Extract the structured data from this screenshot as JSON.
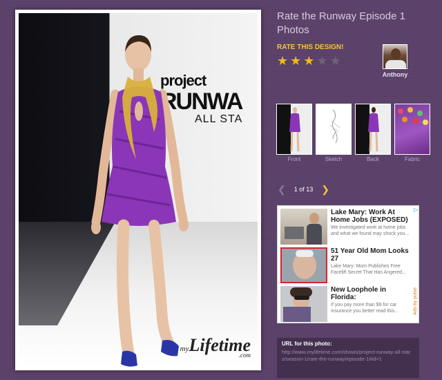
{
  "page": {
    "title": "Rate the Runway Episode 1 Photos",
    "rate_label": "RATE THIS DESIGN!",
    "rating": 3,
    "rating_max": 5
  },
  "photo": {
    "backdrop_text": [
      "project",
      "RUNWA",
      "ALL STA"
    ],
    "watermark": {
      "prefix": "my",
      "brand": "Lifetime",
      "suffix": ".com"
    }
  },
  "judge": {
    "name": "Anthony"
  },
  "thumbnails": [
    {
      "caption": "Front",
      "kind": "front"
    },
    {
      "caption": "Sketch",
      "kind": "sketch"
    },
    {
      "caption": "Back",
      "kind": "back"
    },
    {
      "caption": "Fabric",
      "kind": "fabric"
    }
  ],
  "pager": {
    "current": "1 of 13",
    "prev_icon": "chevron-left-icon",
    "next_icon": "chevron-right-icon"
  },
  "ad": {
    "choices_icon": "adchoices-icon",
    "brand": "Ads by pulse",
    "items": [
      {
        "headline": "Lake Mary: Work At Home Jobs (EXPOSED)",
        "body": "We investigated work at home jobs and what we found may shock you..."
      },
      {
        "headline": "51 Year Old Mom Looks 27",
        "body": "Lake Mary: Mom Publishes Free Facelift Secret That Has Angered..."
      },
      {
        "headline": "New Loophole in Florida:",
        "body": "If you pay more than $9 for car insurance you better read this..."
      }
    ]
  },
  "url_box": {
    "label": "URL for this photo:",
    "value": "http://www.mylifetime.com/shows/project-runway-all-stars/season-1/rate-the-runway/episode-1#id=1"
  },
  "colors": {
    "background": "#5a4068",
    "accent": "#f5c33a",
    "dress": "#8b36b8",
    "gold": "#d8b13a"
  }
}
